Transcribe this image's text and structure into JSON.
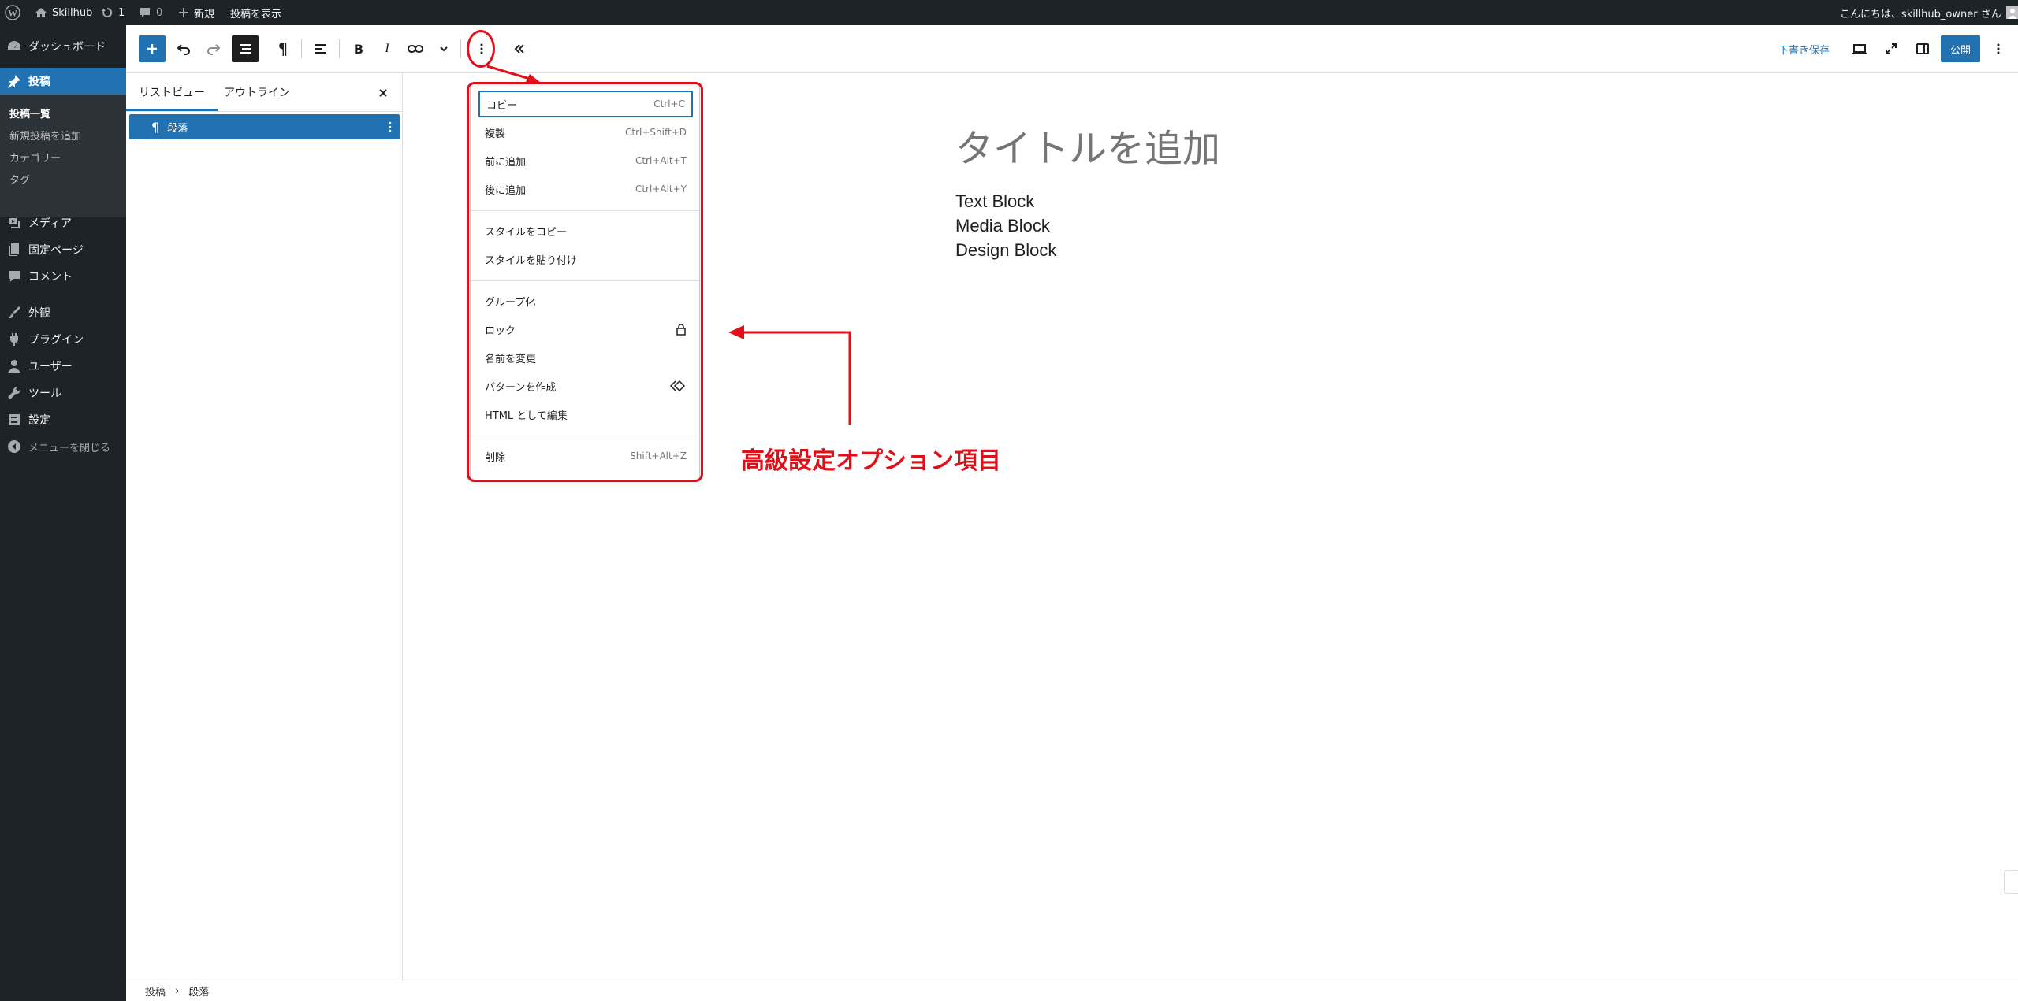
{
  "colors": {
    "accent": "#2271b1",
    "admin_dark": "#1d2327",
    "annotation_red": "#e0101a"
  },
  "adminbar": {
    "site_name": "Skillhub",
    "updates_count": "1",
    "comments_count": "0",
    "new_label": "新規",
    "view_post_label": "投稿を表示",
    "greeting": "こんにちは、skillhub_owner さん"
  },
  "sidebar": {
    "dashboard": "ダッシュボード",
    "posts": "投稿",
    "posts_sub": [
      "投稿一覧",
      "新規投稿を追加",
      "カテゴリー",
      "タグ"
    ],
    "media": "メディア",
    "pages": "固定ページ",
    "comments": "コメント",
    "appearance": "外観",
    "plugins": "プラグイン",
    "users": "ユーザー",
    "tools": "ツール",
    "settings": "設定",
    "collapse": "メニューを閉じる"
  },
  "header": {
    "save_draft": "下書き保存",
    "publish": "公開",
    "icons": [
      "plus-icon",
      "undo-icon",
      "redo-icon",
      "list-view-icon",
      "paragraph-icon",
      "align-icon",
      "bold-icon",
      "italic-icon",
      "link-icon",
      "chevron-down-icon",
      "more-vertical-icon",
      "collapse-icon",
      "preview-icon",
      "fullscreen-icon",
      "sidebar-icon",
      "options-icon"
    ]
  },
  "listview": {
    "tab_list": "リストビュー",
    "tab_outline": "アウトライン",
    "row_label": "段落"
  },
  "canvas": {
    "title_placeholder": "タイトルを追加",
    "paragraphs": [
      "Text Block",
      "Media Block",
      "Design Block"
    ]
  },
  "menu": {
    "group1": [
      {
        "label": "コピー",
        "shortcut": "Ctrl+C"
      },
      {
        "label": "複製",
        "shortcut": "Ctrl+Shift+D"
      },
      {
        "label": "前に追加",
        "shortcut": "Ctrl+Alt+T"
      },
      {
        "label": "後に追加",
        "shortcut": "Ctrl+Alt+Y"
      }
    ],
    "group2": [
      {
        "label": "スタイルをコピー"
      },
      {
        "label": "スタイルを貼り付け"
      }
    ],
    "group3": [
      {
        "label": "グループ化"
      },
      {
        "label": "ロック",
        "icon": "lock-icon"
      },
      {
        "label": "名前を変更"
      },
      {
        "label": "パターンを作成",
        "icon": "pattern-icon"
      },
      {
        "label": "HTML として編集"
      }
    ],
    "group4": [
      {
        "label": "削除",
        "shortcut": "Shift+Alt+Z"
      }
    ]
  },
  "footer": {
    "crumb1": "投稿",
    "crumb2": "段落"
  },
  "annotation": {
    "label": "高級設定オプション項目"
  }
}
